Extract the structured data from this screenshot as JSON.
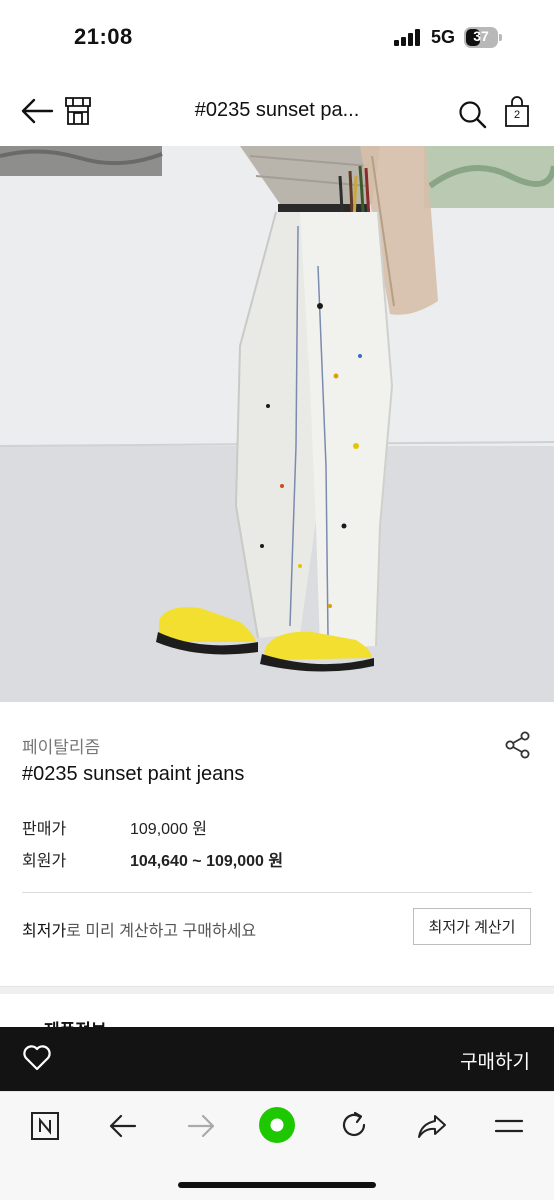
{
  "status_bar": {
    "time": "21:08",
    "network": "5G",
    "battery": "37"
  },
  "header": {
    "title": "#0235 sunset pa...",
    "cart_count": "2",
    "icons": [
      "back-arrow-icon",
      "store-icon",
      "search-icon",
      "shopping-bag-icon"
    ]
  },
  "product": {
    "brand": "페이탈리즘",
    "name": "#0235 sunset paint jeans",
    "price_label": "판매가",
    "price": "109,000 원",
    "member_price_label": "회원가",
    "member_price": "104,640 ~ 109,000 원"
  },
  "promo": {
    "highlight": "최저가",
    "rest": "로 미리 계산하고 구매하세요",
    "button": "최저가 계산기"
  },
  "section_peek": "제품정보",
  "buy_bar": {
    "label": "구매하기"
  },
  "browser_toolbar": {
    "icons": [
      "naver-n-icon",
      "back-icon",
      "forward-icon",
      "green-home-dot-icon",
      "reload-icon",
      "share-icon",
      "menu-icon"
    ]
  },
  "colors": {
    "buy_bar": "#131313",
    "accent_green": "#1ec800",
    "sneakers": "#f2df2f"
  }
}
